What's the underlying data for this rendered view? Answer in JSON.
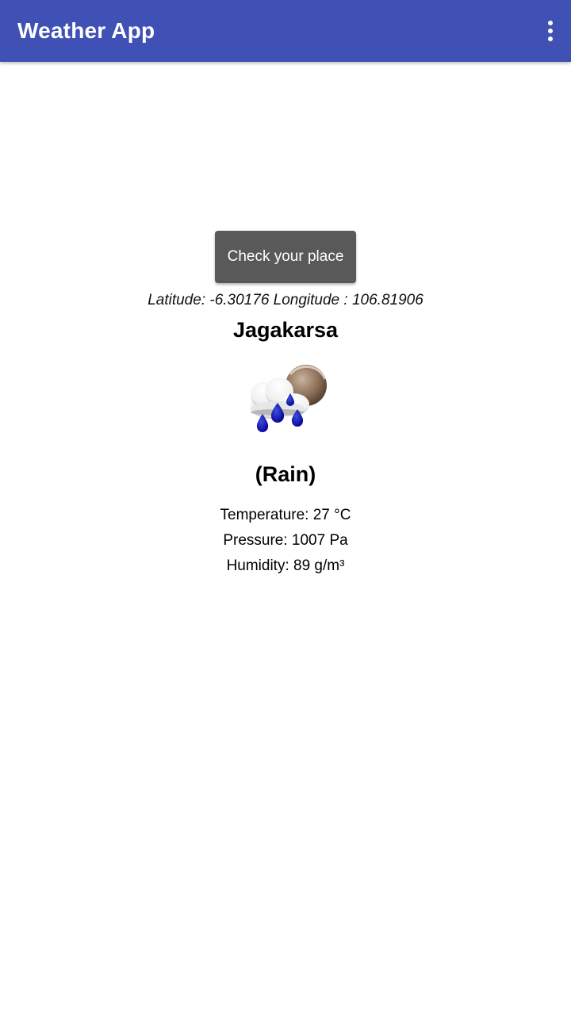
{
  "appbar": {
    "title": "Weather App",
    "overflow_icon": "more-vert-icon",
    "color": "#3f51b5"
  },
  "main": {
    "check_button_label": "Check your place",
    "coordinates_text": "Latitude: -6.30176 Longitude : 106.81906",
    "place_name": "Jagakarsa",
    "weather_icon": "rain-cloud-moon-icon",
    "condition": "(Rain)",
    "temperature": "Temperature: 27 °C",
    "pressure": "Pressure: 1007 Pa",
    "humidity": "Humidity: 89 g/m³"
  }
}
